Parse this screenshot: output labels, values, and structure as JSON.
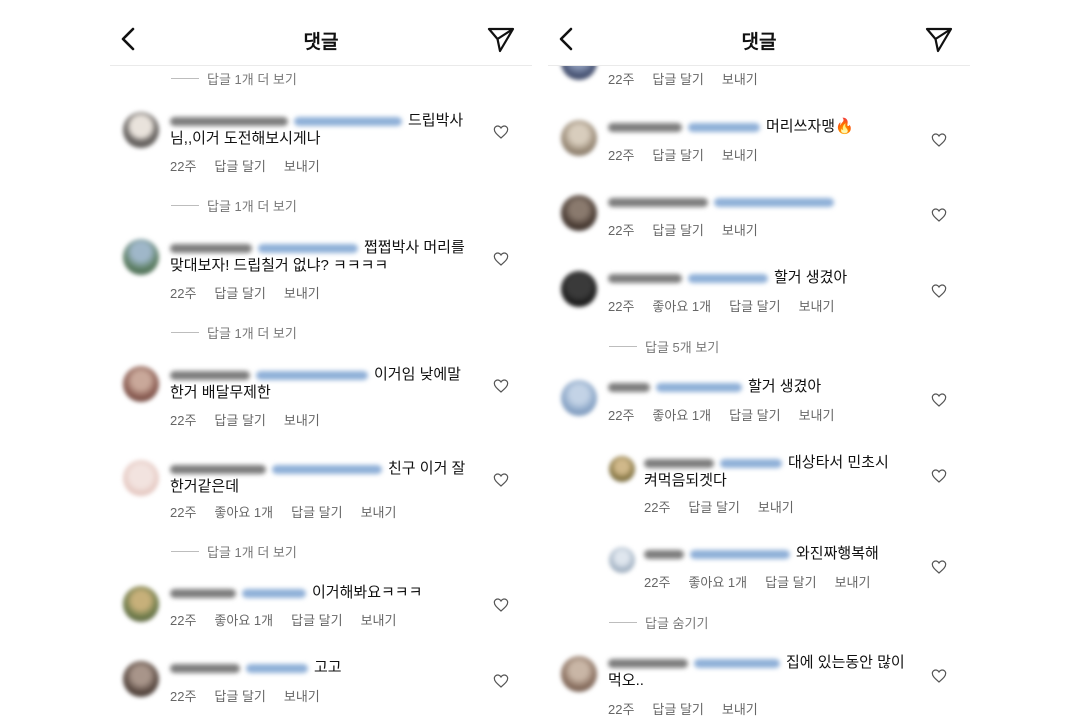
{
  "left": {
    "title": "댓글",
    "more_1": "답글 1개 더 보기",
    "c1": {
      "text_a": "드립박사",
      "text_b": "님,,이거 도전해보시게나",
      "time": "22주",
      "reply": "답글 달기",
      "send": "보내기"
    },
    "more_2": "답글 1개 더 보기",
    "c2": {
      "text_a": "쩝쩝박사 머리를",
      "text_b": "맞대보자! 드립칠거 없냐? ㅋㅋㅋㅋ",
      "time": "22주",
      "reply": "답글 달기",
      "send": "보내기"
    },
    "more_3": "답글 1개 더 보기",
    "c3": {
      "text_a": "이거임 낮에말",
      "text_b": "한거 배달무제한",
      "time": "22주",
      "reply": "답글 달기",
      "send": "보내기"
    },
    "c4": {
      "text_a": "친구 이거 잘",
      "text_b": "한거같은데",
      "time": "22주",
      "likes": "좋아요 1개",
      "reply": "답글 달기",
      "send": "보내기"
    },
    "more_4": "답글 1개 더 보기",
    "c5": {
      "text_a": "이거해봐요ㅋㅋㅋ",
      "time": "22주",
      "likes": "좋아요 1개",
      "reply": "답글 달기",
      "send": "보내기"
    },
    "c6": {
      "text_a": "고고",
      "time": "22주",
      "reply": "답글 달기",
      "send": "보내기"
    }
  },
  "right": {
    "title": "댓글",
    "c0": {
      "time": "22주",
      "reply": "답글 달기",
      "send": "보내기"
    },
    "c1": {
      "text_a": "머리쓰자맹🔥",
      "time": "22주",
      "reply": "답글 달기",
      "send": "보내기"
    },
    "c2": {
      "time": "22주",
      "reply": "답글 달기",
      "send": "보내기"
    },
    "c3": {
      "text_a": "할거 생겼아",
      "time": "22주",
      "likes": "좋아요 1개",
      "reply": "답글 달기",
      "send": "보내기"
    },
    "more_1": "답글 5개 보기",
    "c4": {
      "text_a": "할거 생겼아",
      "time": "22주",
      "likes": "좋아요 1개",
      "reply": "답글 달기",
      "send": "보내기"
    },
    "r1": {
      "text_a": "대상타서 민초시",
      "text_b": "켜먹음되겟다",
      "time": "22주",
      "reply": "답글 달기",
      "send": "보내기"
    },
    "r2": {
      "text_a": "와진짜행복해",
      "time": "22주",
      "likes": "좋아요 1개",
      "reply": "답글 달기",
      "send": "보내기"
    },
    "hide": "답글 숨기기",
    "c5": {
      "text_a": "집에 있는동안 많이",
      "text_b": "먹오..",
      "time": "22주",
      "reply": "답글 달기",
      "send": "보내기"
    }
  },
  "colors": {
    "accent_blur": "#8fb0d8",
    "meta": "#666666",
    "divider": "#eaeaea"
  },
  "icons": [
    "back-chevron-icon",
    "send-paper-plane-icon",
    "heart-outline-icon"
  ]
}
